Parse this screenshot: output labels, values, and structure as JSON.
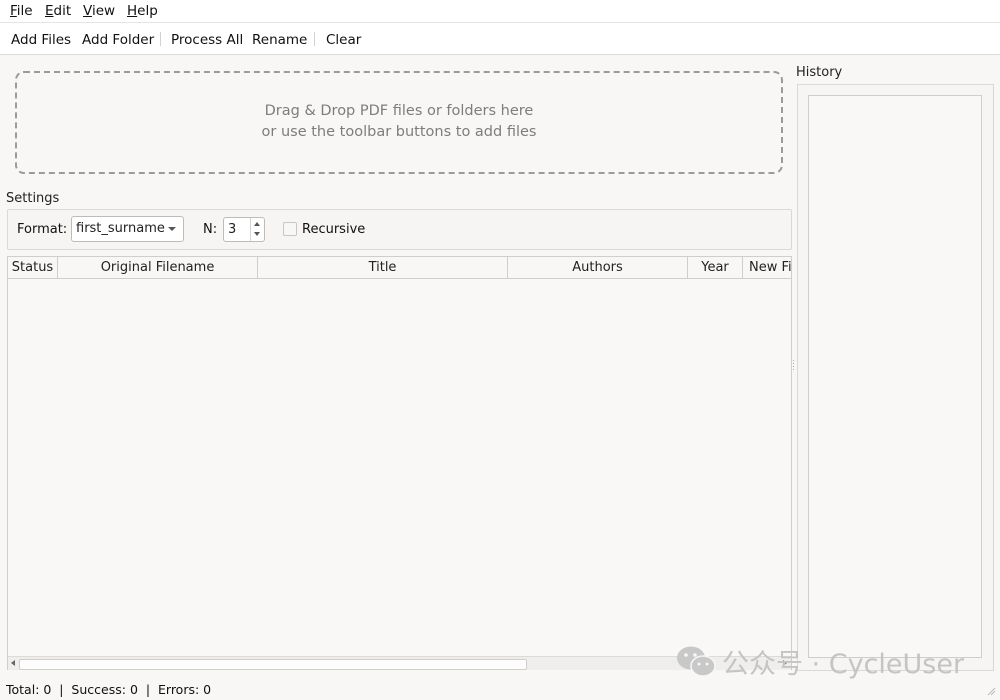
{
  "menubar": {
    "items": [
      {
        "label": "File"
      },
      {
        "label": "Edit"
      },
      {
        "label": "View"
      },
      {
        "label": "Help"
      }
    ]
  },
  "toolbar": {
    "add_files": "Add Files",
    "add_folder": "Add Folder",
    "process_all": "Process All",
    "rename": "Rename",
    "clear": "Clear"
  },
  "dropzone": {
    "line1": "Drag & Drop PDF files or folders here",
    "line2": "or use the toolbar buttons to add files"
  },
  "settings": {
    "title": "Settings",
    "format_label": "Format:",
    "format_value": "first_surname",
    "n_label": "N:",
    "n_value": "3",
    "recursive_label": "Recursive",
    "recursive_checked": false
  },
  "table": {
    "columns": [
      "Status",
      "Original Filename",
      "Title",
      "Authors",
      "Year",
      "New Fi"
    ],
    "rows": []
  },
  "history": {
    "title": "History",
    "items": []
  },
  "statusbar": {
    "text": "Total: 0  |  Success: 0  |  Errors: 0"
  },
  "watermark": {
    "text": "公众号 · CycleUser"
  }
}
